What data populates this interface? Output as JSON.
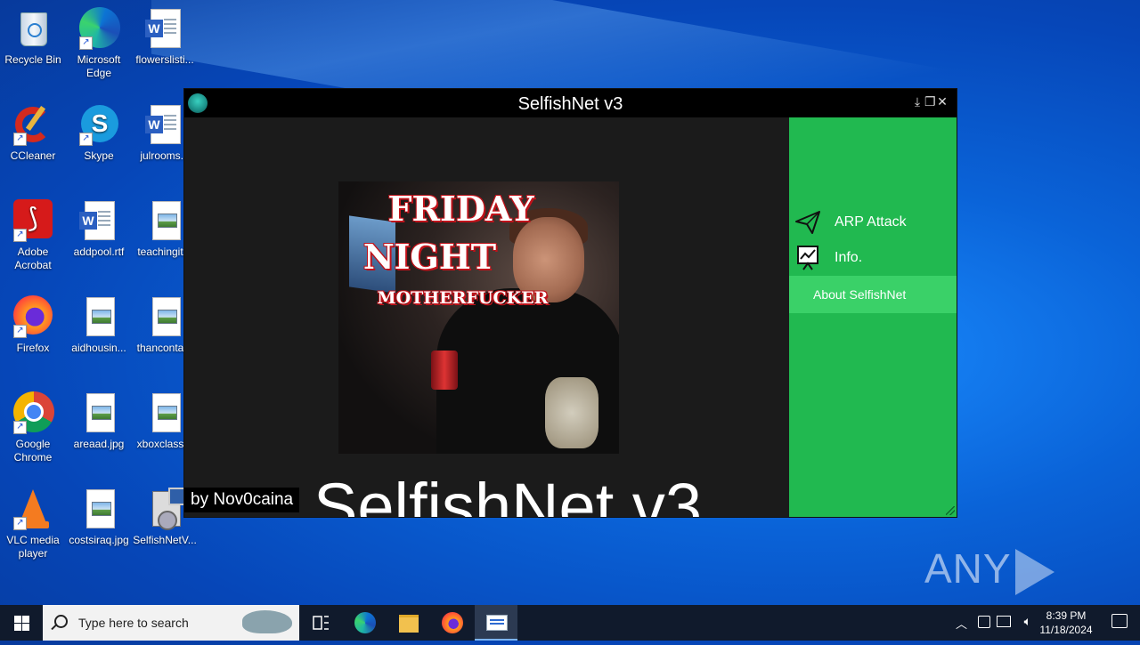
{
  "desktop": {
    "icons": [
      {
        "label": "Recycle Bin"
      },
      {
        "label": "Microsoft Edge"
      },
      {
        "label": "flowerslisti..."
      },
      {
        "label": "CCleaner"
      },
      {
        "label": "Skype"
      },
      {
        "label": "julrooms..."
      },
      {
        "label": "Adobe Acrobat"
      },
      {
        "label": "addpool.rtf"
      },
      {
        "label": "teachingit..."
      },
      {
        "label": "Firefox"
      },
      {
        "label": "aidhousin..."
      },
      {
        "label": "thanconta..."
      },
      {
        "label": "Google Chrome"
      },
      {
        "label": "areaad.jpg"
      },
      {
        "label": "xboxclass..."
      },
      {
        "label": "VLC media player"
      },
      {
        "label": "costsiraq.jpg"
      },
      {
        "label": "SelfishNetV..."
      }
    ]
  },
  "app": {
    "title": "SelfishNet v3",
    "window_buttons": {
      "download": "⤓",
      "restore": "❐",
      "close": "✕"
    },
    "banner": {
      "line1": "FRIDAY",
      "line2": "NIGHT",
      "line3": "MOTHERFUCKER"
    },
    "big_title": "SelfishNet v3",
    "byline": "by Nov0caina",
    "menu": [
      {
        "label": "ARP Attack",
        "icon": "paper-plane-icon"
      },
      {
        "label": "Info.",
        "icon": "chart-board-icon"
      }
    ],
    "about_label": "About SelfishNet",
    "accent_color": "#21b950"
  },
  "watermark": {
    "left": "ANY",
    "right": "RUN"
  },
  "taskbar": {
    "search_placeholder": "Type here to search",
    "time": "8:39 PM",
    "date": "11/18/2024"
  }
}
